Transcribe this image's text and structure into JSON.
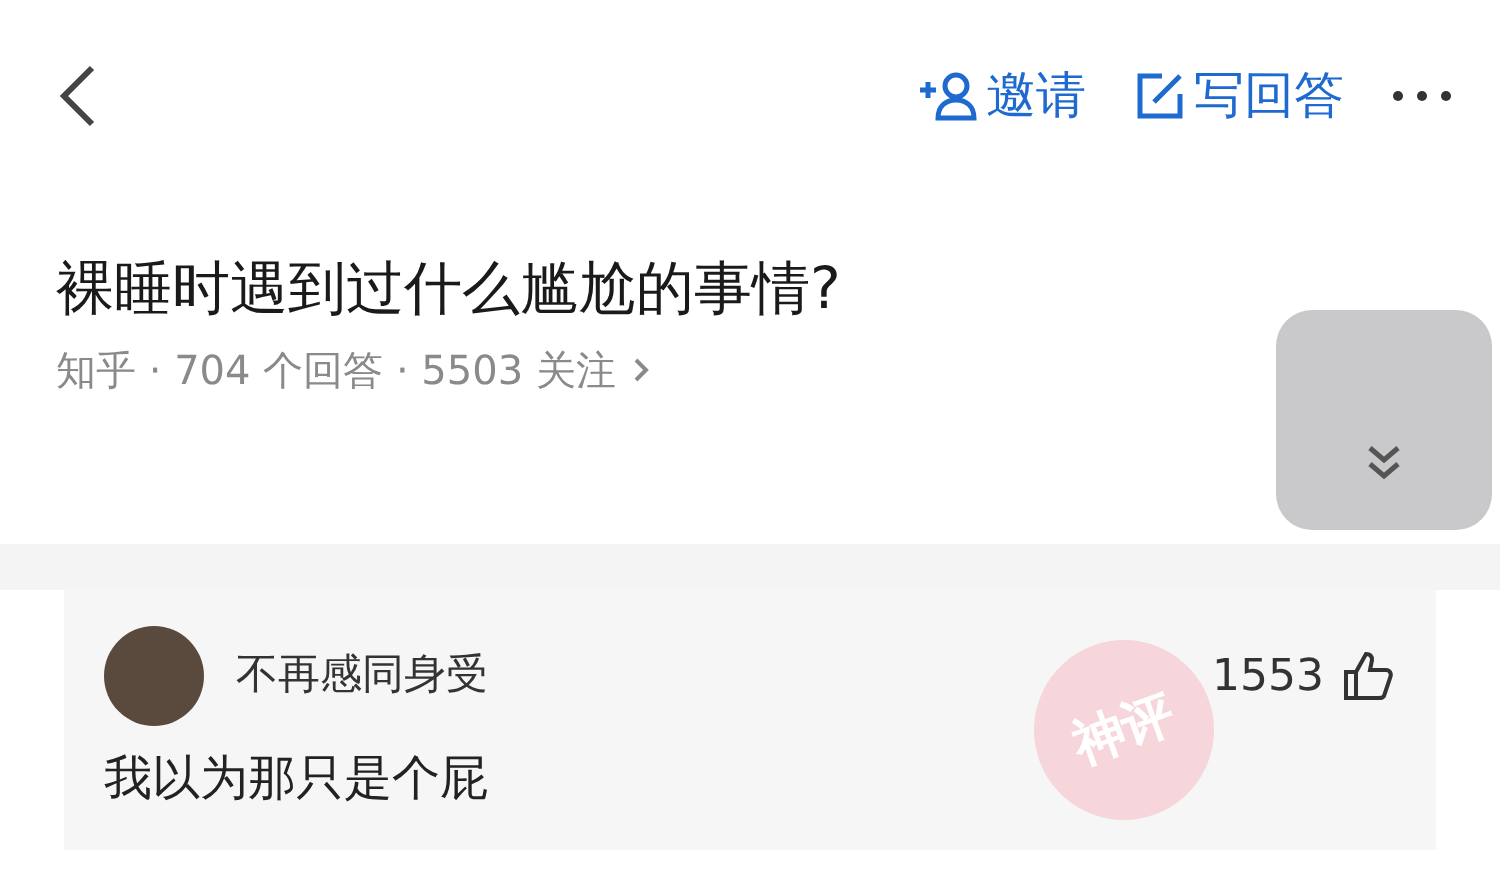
{
  "nav": {
    "actions": [
      {
        "kind": "invite",
        "label": "邀请"
      },
      {
        "kind": "write",
        "label": "写回答"
      }
    ]
  },
  "question": {
    "title": "裸睡时遇到过什么尴尬的事情?",
    "meta": "知乎 · 704 个回答 · 5503 关注"
  },
  "comment": {
    "author": "不再感同身受",
    "likes": "1553",
    "text": "我以为那只是个屁",
    "stamp": "神评"
  }
}
